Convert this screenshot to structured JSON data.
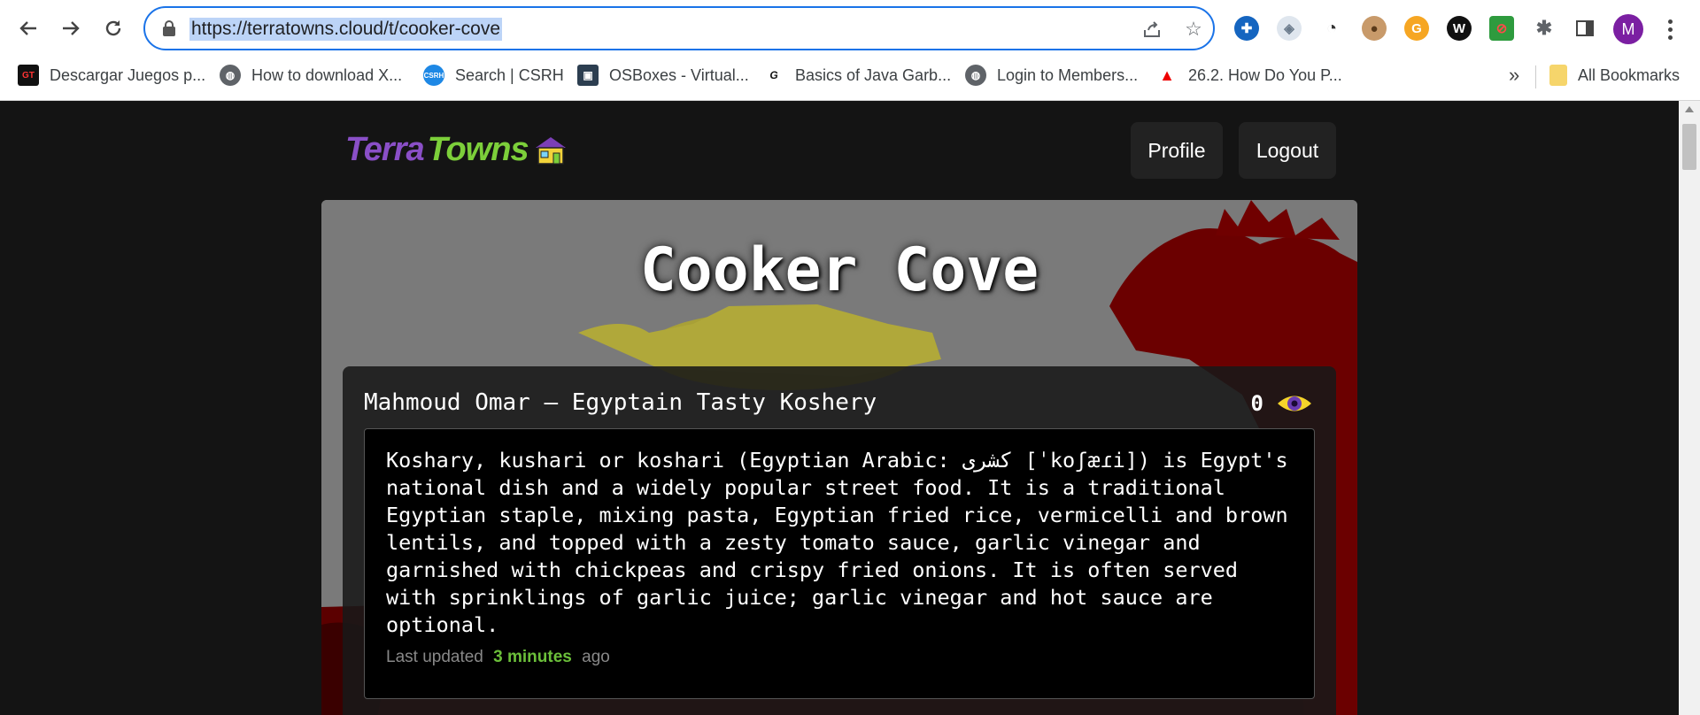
{
  "browser": {
    "url": "https://terratowns.cloud/t/cooker-cove",
    "bookmarks": [
      {
        "label": "Descargar Juegos p...",
        "icon": "gt-icon"
      },
      {
        "label": "How to download X...",
        "icon": "globe-icon"
      },
      {
        "label": "Search | CSRH",
        "icon": "csrh-icon"
      },
      {
        "label": "OSBoxes - Virtual...",
        "icon": "cube-icon"
      },
      {
        "label": "Basics of Java Garb...",
        "icon": "ga-icon"
      },
      {
        "label": "Login to Members...",
        "icon": "globe-icon"
      },
      {
        "label": "26.2. How Do You P...",
        "icon": "redhat-icon"
      }
    ],
    "all_bookmarks_label": "All Bookmarks",
    "profile_initial": "M"
  },
  "header": {
    "logo_part1": "TerraTowns",
    "profile_button": "Profile",
    "logout_button": "Logout"
  },
  "town": {
    "title": "Cooker Cove"
  },
  "home": {
    "title": "Mahmoud Omar – Egyptain Tasty Koshery",
    "visits": "0",
    "description": "Koshary, kushari or koshari (Egyptian Arabic: كشرى [ˈkoʃæɾi]) is Egypt's national dish and a widely popular street food. It is a traditional Egyptian staple, mixing pasta, Egyptian fried rice, vermicelli and brown lentils, and topped with a zesty tomato sauce, garlic vinegar and garnished with chickpeas and crispy fried onions. It is often served with sprinklings of garlic juice; garlic vinegar and hot sauce are optional.",
    "updated_prefix": "Last updated",
    "updated_value": "3 minutes",
    "updated_suffix": "ago"
  },
  "colors": {
    "terra": "#8a4fc7",
    "towns": "#7ccf3a",
    "accent_green": "#6bbf3a",
    "page_bg": "#141414"
  }
}
